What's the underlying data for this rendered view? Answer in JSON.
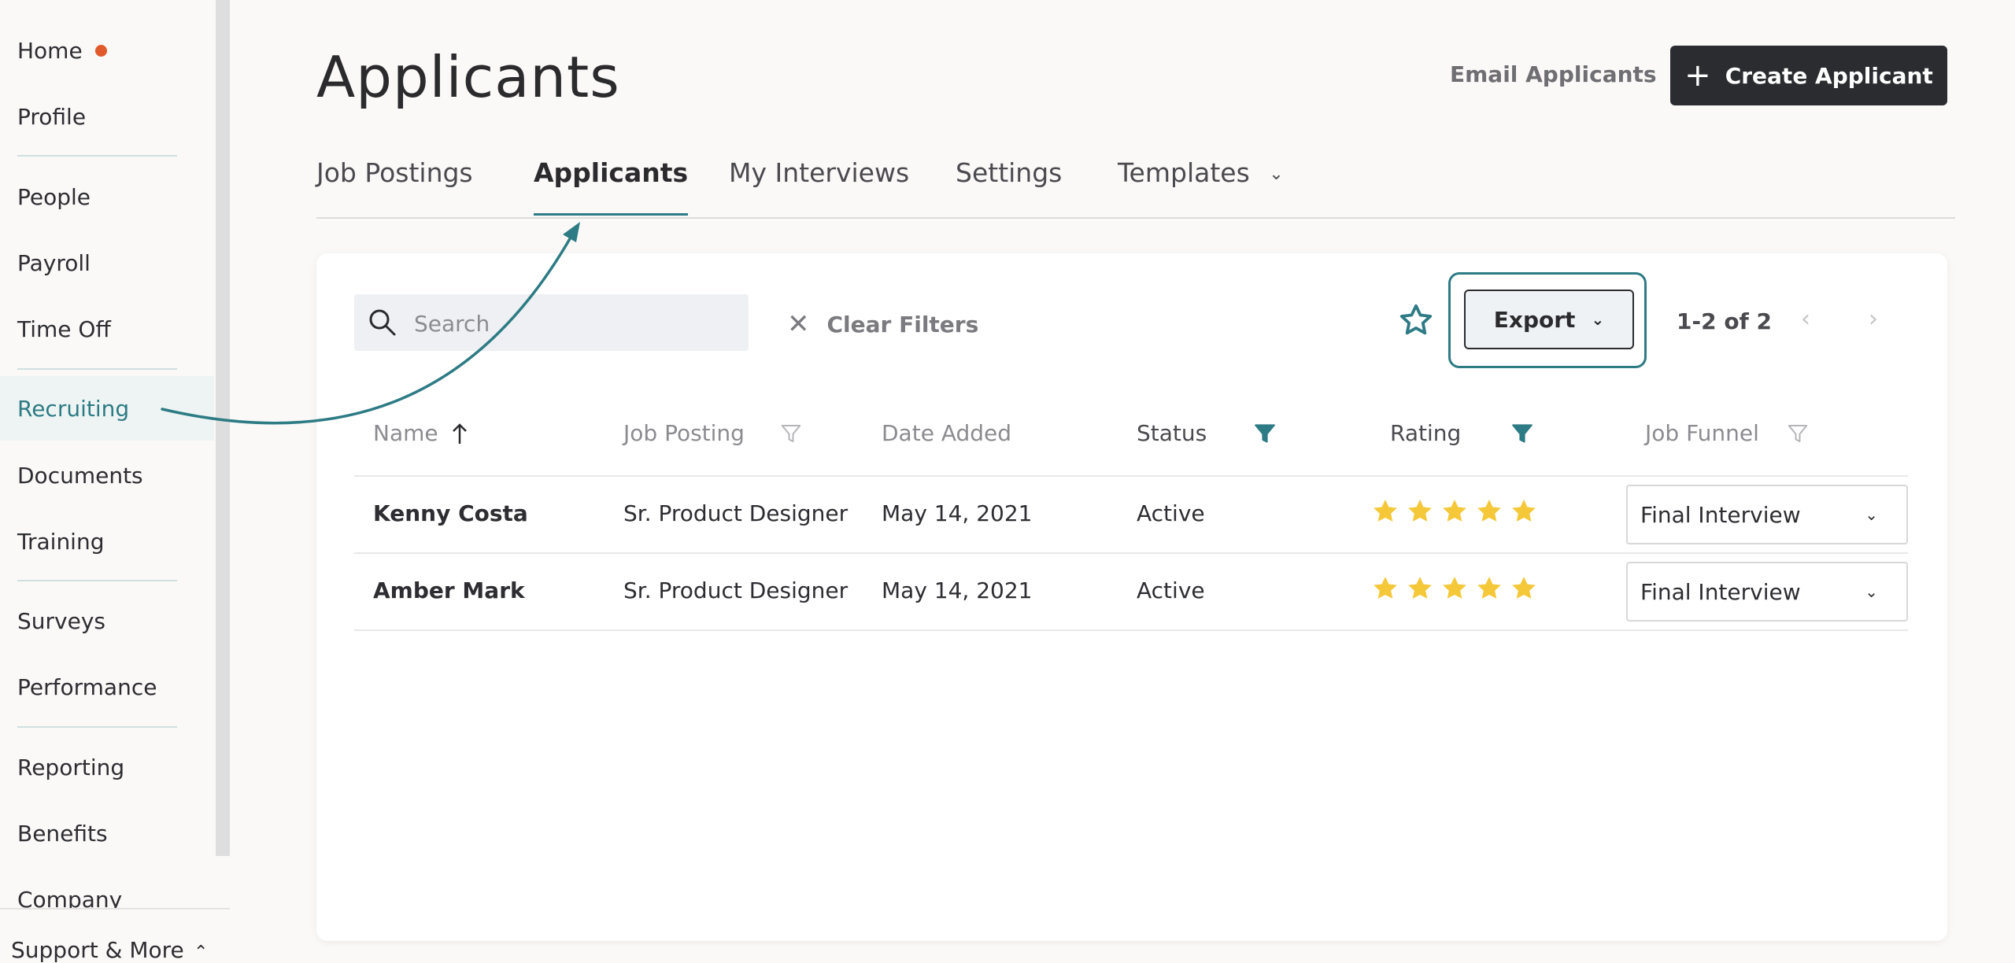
{
  "sidebar": {
    "items": [
      {
        "label": "Home",
        "dot": true
      },
      {
        "label": "Profile"
      },
      {
        "label": "People"
      },
      {
        "label": "Payroll"
      },
      {
        "label": "Time Off"
      },
      {
        "label": "Recruiting",
        "active": true
      },
      {
        "label": "Documents"
      },
      {
        "label": "Training"
      },
      {
        "label": "Surveys"
      },
      {
        "label": "Performance"
      },
      {
        "label": "Reporting"
      },
      {
        "label": "Benefits"
      },
      {
        "label": "Company"
      }
    ],
    "bottom_label": "Support & More"
  },
  "header": {
    "title": "Applicants",
    "email_link": "Email Applicants",
    "create_button": "Create Applicant"
  },
  "tabs": [
    {
      "label": "Job Postings"
    },
    {
      "label": "Applicants",
      "active": true
    },
    {
      "label": "My Interviews"
    },
    {
      "label": "Settings"
    },
    {
      "label": "Templates",
      "dropdown": true
    }
  ],
  "toolbar": {
    "search_placeholder": "Search",
    "search_value": "",
    "clear_filters": "Clear Filters",
    "export_label": "Export",
    "pager_count": "1-2 of 2"
  },
  "table": {
    "columns": [
      {
        "label": "Name",
        "sort": "ascending"
      },
      {
        "label": "Job Posting",
        "filter": "inactive"
      },
      {
        "label": "Date Added"
      },
      {
        "label": "Status",
        "filter": "active"
      },
      {
        "label": "Rating",
        "filter": "active"
      },
      {
        "label": "Job Funnel",
        "filter": "inactive"
      }
    ],
    "rows": [
      {
        "name": "Kenny Costa",
        "job_posting": "Sr. Product Designer",
        "date_added": "May 14, 2021",
        "status": "Active",
        "rating": 5,
        "job_funnel": "Final Interview"
      },
      {
        "name": "Amber Mark",
        "job_posting": "Sr. Product Designer",
        "date_added": "May 14, 2021",
        "status": "Active",
        "rating": 5,
        "job_funnel": "Final Interview"
      }
    ]
  },
  "colors": {
    "accent": "#2d7b84",
    "star": "#f5c83a",
    "dark_button": "#2a2c30",
    "home_dot": "#e05a2b"
  }
}
